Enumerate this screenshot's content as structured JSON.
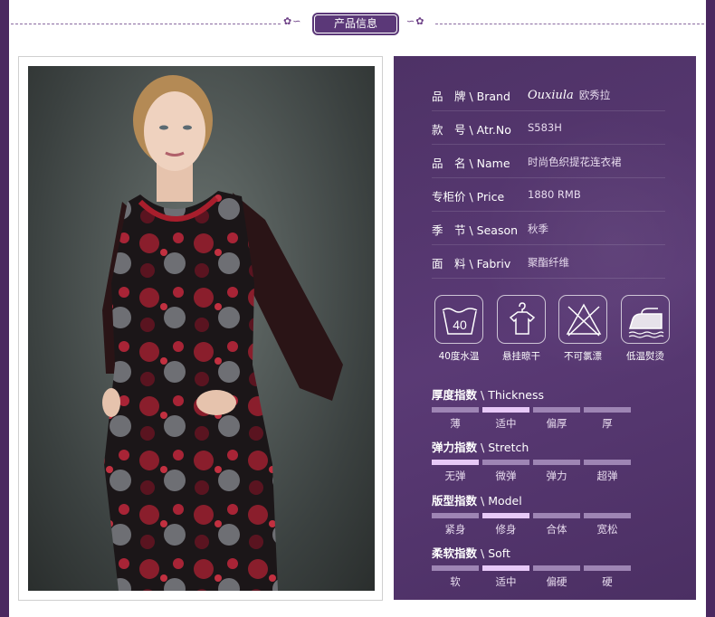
{
  "header": {
    "title": "产品信息"
  },
  "specs": [
    {
      "label": "品　牌 \\ Brand",
      "logo": "Ouxiula",
      "value": "欧秀拉"
    },
    {
      "label": "款　号 \\ Atr.No",
      "value": "S583H"
    },
    {
      "label": "品　名 \\ Name",
      "value": "时尚色织提花连衣裙"
    },
    {
      "label": "专柜价 \\ Price",
      "value": "1880  RMB"
    },
    {
      "label": "季　节 \\ Season",
      "value": "秋季"
    },
    {
      "label": "面　料 \\ Fabriv",
      "value": "聚酯纤维"
    }
  ],
  "care": [
    {
      "icon": "wash-40-icon",
      "label": "40度水温",
      "number": "40"
    },
    {
      "icon": "hang-dry-icon",
      "label": "悬挂晾干"
    },
    {
      "icon": "no-bleach-icon",
      "label": "不可氯漂"
    },
    {
      "icon": "low-iron-icon",
      "label": "低温熨烫"
    }
  ],
  "scales": [
    {
      "title_cn": "厚度指数",
      "title_en": "Thickness",
      "options": [
        "薄",
        "适中",
        "偏厚",
        "厚"
      ],
      "selected": 1
    },
    {
      "title_cn": "弹力指数",
      "title_en": "Stretch",
      "options": [
        "无弹",
        "微弹",
        "弹力",
        "超弹"
      ],
      "selected": 0
    },
    {
      "title_cn": "版型指数",
      "title_en": "Model",
      "options": [
        "紧身",
        "修身",
        "合体",
        "宽松"
      ],
      "selected": 1
    },
    {
      "title_cn": "柔软指数",
      "title_en": "Soft",
      "options": [
        "软",
        "适中",
        "偏硬",
        "硬"
      ],
      "selected": 1
    }
  ],
  "colors": {
    "frame": "#4a2860",
    "panel": "#533570",
    "scale_off": "#9e85b4",
    "scale_on": "#e7c9f7"
  }
}
